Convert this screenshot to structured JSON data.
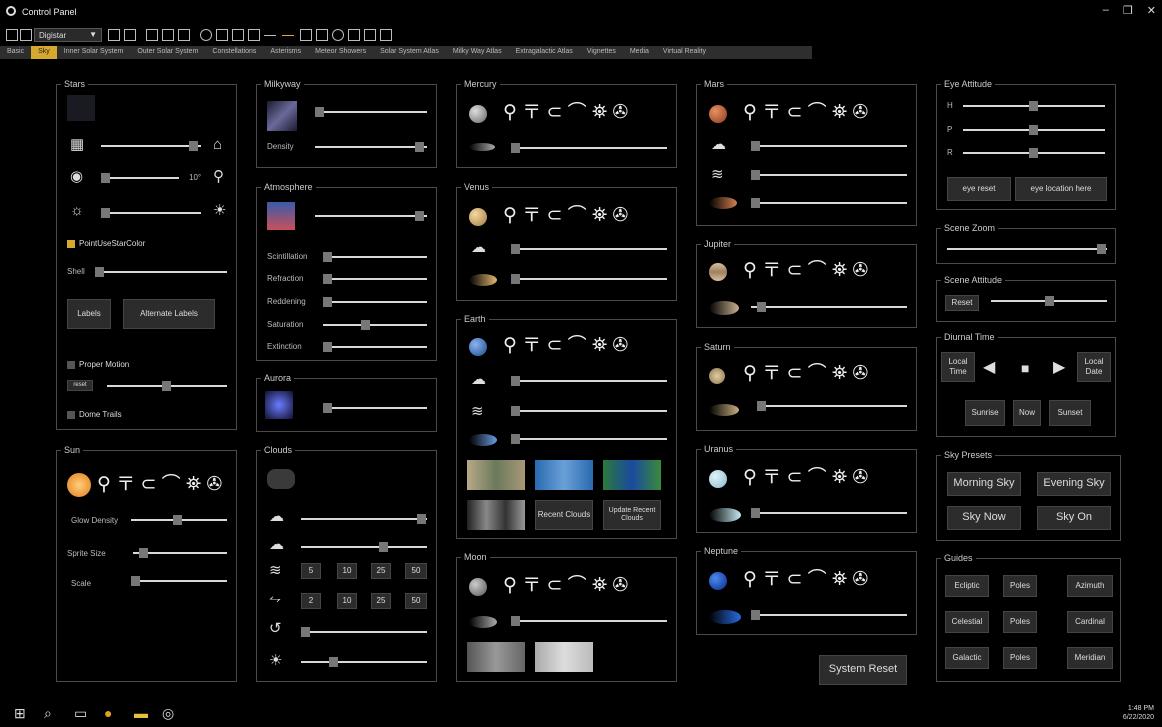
{
  "window": {
    "title": "Control Panel",
    "controls": [
      "–",
      "❐",
      "✕"
    ]
  },
  "toolbar": {
    "select_value": "Digistar"
  },
  "tabs": [
    "Basic",
    "Sky",
    "Inner Solar System",
    "Outer Solar System",
    "Constellations",
    "Asterisms",
    "Meteor Showers",
    "Solar System Atlas",
    "Milky Way Atlas",
    "Extragalactic Atlas",
    "Vignettes",
    "Media",
    "Virtual Reality"
  ],
  "active_tab": "Sky",
  "stars": {
    "title": "Stars",
    "magnitude_value": "10°",
    "point_color_label": "PointUseStarColor",
    "shell_label": "Shell",
    "labels_button": "Labels",
    "alt_labels_button": "Alternate Labels",
    "proper_motion_label": "Proper Motion",
    "reset_label": "reset",
    "dome_trails_label": "Dome Trails"
  },
  "sun": {
    "title": "Sun",
    "glow_label": "Glow Density",
    "sprite_label": "Sprite Size",
    "scale_label": "Scale"
  },
  "milkyway": {
    "title": "Milkyway",
    "density_label": "Density"
  },
  "atmosphere": {
    "title": "Atmosphere",
    "rows": [
      "Scintillation",
      "Refraction",
      "Reddening",
      "Saturation",
      "Extinction"
    ]
  },
  "aurora": {
    "title": "Aurora"
  },
  "clouds": {
    "title": "Clouds",
    "speed_values": [
      "5",
      "10",
      "25",
      "50"
    ],
    "wind_values": [
      "2",
      "10",
      "25",
      "50"
    ]
  },
  "mercury": {
    "title": "Mercury"
  },
  "venus": {
    "title": "Venus"
  },
  "earth": {
    "title": "Earth",
    "recent_clouds": "Recent Clouds",
    "update_clouds": "Update Recent Clouds"
  },
  "moon": {
    "title": "Moon"
  },
  "mars": {
    "title": "Mars"
  },
  "jupiter": {
    "title": "Jupiter"
  },
  "saturn": {
    "title": "Saturn"
  },
  "uranus": {
    "title": "Uranus"
  },
  "neptune": {
    "title": "Neptune"
  },
  "system_reset": "System Reset",
  "eye_attitude": {
    "title": "Eye Attitude",
    "rows": [
      "H",
      "P",
      "R"
    ],
    "eye_reset": "eye reset",
    "eye_location": "eye location here"
  },
  "scene_zoom": {
    "title": "Scene Zoom"
  },
  "scene_attitude": {
    "title": "Scene Attitude",
    "reset": "Reset"
  },
  "diurnal": {
    "title": "Diurnal Time",
    "local_time": "Local Time",
    "local_date": "Local Date",
    "sunrise": "Sunrise",
    "now": "Now",
    "sunset": "Sunset"
  },
  "sky_presets": {
    "title": "Sky Presets",
    "buttons": [
      "Morning Sky",
      "Evening Sky",
      "Sky Now",
      "Sky On"
    ]
  },
  "guides": {
    "title": "Guides",
    "buttons": [
      "Ecliptic",
      "Poles",
      "Azimuth",
      "Celestial",
      "Poles",
      "Cardinal",
      "Galactic",
      "Poles",
      "Meridian"
    ]
  },
  "planet_icons": "⚲ 〒 ⊂ ⌒ ⛯ ✇",
  "taskbar": {
    "time": "1:48 PM",
    "date": "6/22/2020"
  },
  "colors": {
    "accent": "#d6a92e",
    "background": "#000000",
    "panel_border": "#4a4a4a"
  }
}
